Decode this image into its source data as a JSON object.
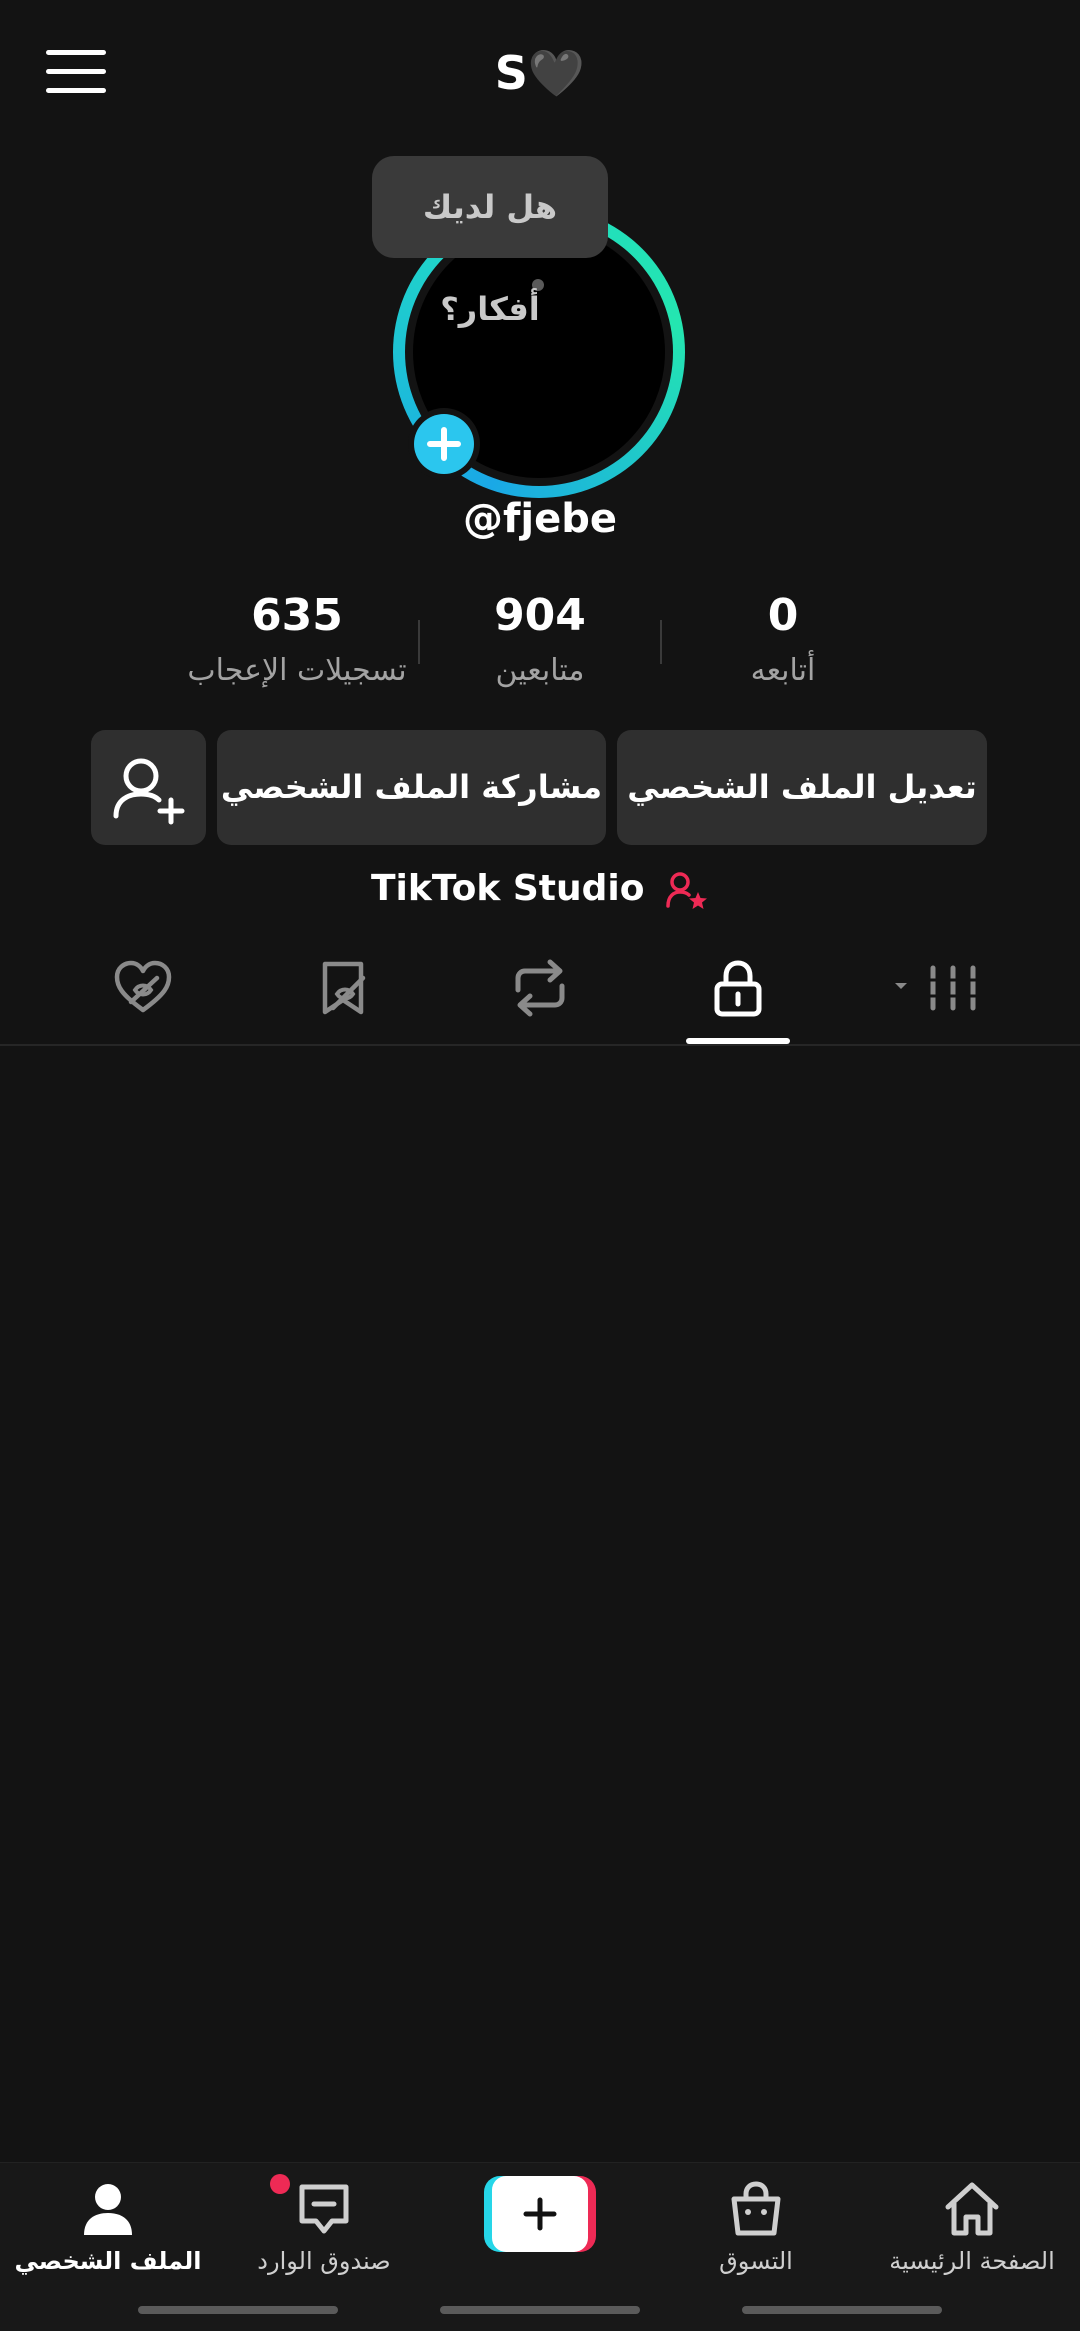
{
  "header": {
    "title": "S🖤",
    "menu_icon": "hamburger-menu-icon"
  },
  "tooltip": {
    "text": "هل لديك أفكار؟"
  },
  "profile": {
    "username": "@fjebe"
  },
  "stats": [
    {
      "value": "635",
      "label": "تسجيلات الإعجاب"
    },
    {
      "value": "904",
      "label": "متابعين"
    },
    {
      "value": "0",
      "label": "أتابعه"
    }
  ],
  "buttons": {
    "edit_profile": "تعديل الملف الشخصي",
    "share_profile": "مشاركة الملف الشخصي",
    "add_friend_icon": "add-user-icon"
  },
  "studio": {
    "label": "TikTok Studio",
    "icon": "creator-star-icon",
    "icon_color": "#ee2a55"
  },
  "tabs": [
    {
      "icon": "liked-hidden-icon"
    },
    {
      "icon": "favorites-hidden-icon"
    },
    {
      "icon": "repost-icon"
    },
    {
      "icon": "lock-icon",
      "active": true
    },
    {
      "icon": "grid-videos-icon"
    }
  ],
  "nav": {
    "profile": "الملف الشخصي",
    "inbox": "صندوق الوارد",
    "shop": "التسوق",
    "home": "الصفحة الرئيسية",
    "create_icon": "plus-icon"
  },
  "colors": {
    "accent_blue": "#2bc6ee",
    "accent_red": "#ee2a55",
    "background": "#131313"
  }
}
